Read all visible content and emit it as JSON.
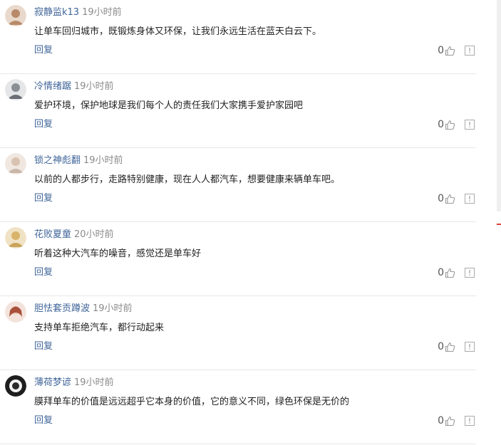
{
  "comments": [
    {
      "username": "寂静监k13",
      "time": "19小时前",
      "content": "让单车回归城市，既锻炼身体又环保，让我们永远生活在蓝天白云下。",
      "reply_label": "回复",
      "likes": "0",
      "avatar_color": "#b88a6a"
    },
    {
      "username": "冷情绪踞",
      "time": "19小时前",
      "content": "爱护环境，保护地球是我们每个人的责任我们大家携手爱护家园吧",
      "reply_label": "回复",
      "likes": "0",
      "avatar_color": "#8a8f96"
    },
    {
      "username": "锁之神彪翻",
      "time": "19小时前",
      "content": "以前的人都步行，走路特别健康，现在人人都汽车，想要健康来辆单车吧。",
      "reply_label": "回复",
      "likes": "0",
      "avatar_color": "#c9b6a8"
    },
    {
      "username": "花败夏童",
      "time": "20小时前",
      "content": "听着这种大汽车的噪音，感觉还是单车好",
      "reply_label": "回复",
      "likes": "0",
      "avatar_color": "#c9a45a"
    },
    {
      "username": "胆怯套贡蹲波",
      "time": "19小时前",
      "content": "支持单车拒绝汽车，都行动起来",
      "reply_label": "回复",
      "likes": "0",
      "avatar_color": "#a8503a"
    },
    {
      "username": "薄荷梦谚",
      "time": "19小时前",
      "content": "膜拜单车的价值是远远超乎它本身的价值，它的意义不同，绿色环保是无价的",
      "reply_label": "回复",
      "likes": "0",
      "avatar_color": "#2a2a2a"
    }
  ],
  "colors": {
    "username": "#406599",
    "time": "#8a8a8a",
    "accent_marker": "#e04040"
  },
  "icons": {
    "like": "thumbs-up-icon",
    "report": "report-icon"
  }
}
